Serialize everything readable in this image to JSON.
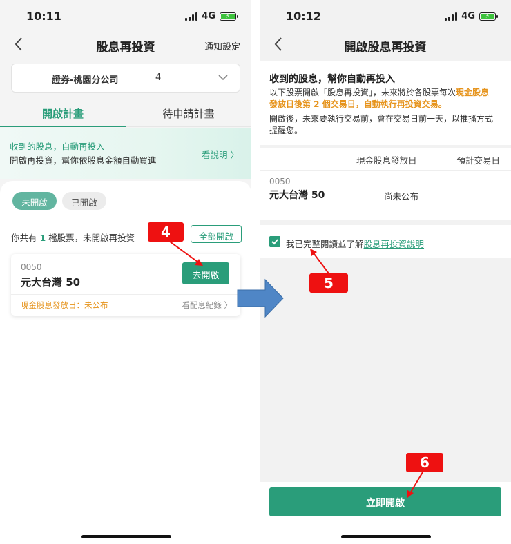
{
  "left": {
    "status": {
      "time": "10:11",
      "network": "4G"
    },
    "nav": {
      "title": "股息再投資",
      "right_link": "通知設定"
    },
    "account": {
      "name": "證券-桃園分公司",
      "number": "4"
    },
    "tabs": [
      {
        "label": "開啟計畫"
      },
      {
        "label": "待申請計畫"
      }
    ],
    "promo": {
      "line1": "收到的股息，自動再投入",
      "line2": "開啟再投資，幫你依股息金額自動買進",
      "link": "看說明"
    },
    "filters": [
      {
        "label": "未開啟"
      },
      {
        "label": "已開啟"
      }
    ],
    "summary": {
      "prefix": "你共有 ",
      "count": "1",
      "suffix": " 檔股票，未開啟再投資",
      "all_button": "全部開啟"
    },
    "card": {
      "code": "0050",
      "name": "元大台灣 50",
      "open_button": "去開啟",
      "date_label": "現金股息發放日：未公布",
      "history_link": "看配息紀錄"
    }
  },
  "right": {
    "status": {
      "time": "10:12",
      "network": "4G"
    },
    "nav": {
      "title": "開啟股息再投資"
    },
    "intro": {
      "heading": "收到的股息，幫你自動再投入",
      "p1_a": "以下股票開啟「股息再投資」，未來將於各股票每次",
      "p1_highlight": "現金股息發放日後第 2 個交易日，自動執行再投資交易。",
      "p2": "開啟後，未來要執行交易前，會在交易日前一天，以推播方式提醒您。"
    },
    "table": {
      "headers": [
        "現金股息發放日",
        "預計交易日"
      ],
      "row": {
        "code": "0050",
        "name": "元大台灣 50",
        "pay_date": "尚未公布",
        "trade_date": "--"
      }
    },
    "agree": {
      "text": "我已完整閱讀並了解",
      "link": "股息再投資說明"
    },
    "cta": "立即開啟"
  },
  "annotations": {
    "step4": "4",
    "step5": "5",
    "step6": "6"
  },
  "colors": {
    "brand": "#2a9d7a",
    "accent_orange": "#e6931b",
    "marker_red": "#ee1111",
    "arrow_blue": "#4f86c6"
  }
}
